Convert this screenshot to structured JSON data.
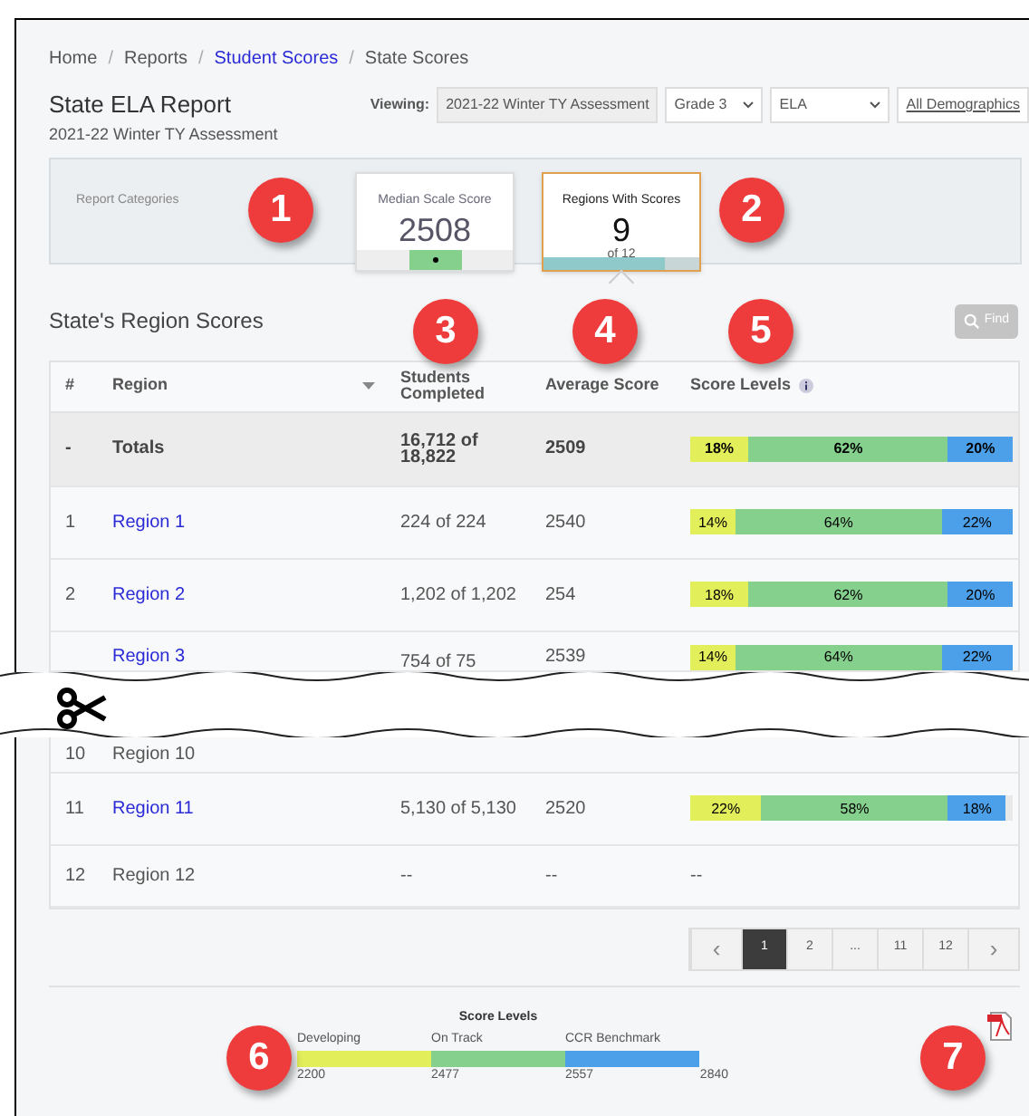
{
  "breadcrumb": [
    {
      "label": "Home",
      "kind": "plain"
    },
    {
      "label": "Reports",
      "kind": "plain"
    },
    {
      "label": "Student Scores",
      "kind": "link"
    },
    {
      "label": "State Scores",
      "kind": "plain"
    }
  ],
  "breadcrumb_separator": "/",
  "title": "State ELA Report",
  "subtitle": "2021-22 Winter TY Assessment",
  "viewing": {
    "label": "Viewing:",
    "assessment": "2021-22 Winter TY Assessment",
    "grade": "Grade 3",
    "subject": "ELA",
    "demographics": "All Demographics"
  },
  "categories": {
    "label": "Report Categories",
    "cards": [
      {
        "kind": "median",
        "title": "Median Scale Score",
        "value": "2508",
        "selected": false
      },
      {
        "kind": "regions",
        "title": "Regions With Scores",
        "value": "9",
        "sub": "of 12",
        "selected": true,
        "level": 0.78
      }
    ]
  },
  "section_title": "State's Region Scores",
  "find_button": "Find",
  "table": {
    "columns": [
      "#",
      "Region",
      "Students Completed",
      "Average Score",
      "Score Levels"
    ],
    "rows_top": [
      {
        "kind": "total",
        "num": "-",
        "region": "Totals",
        "students": "16,712 of 18,822",
        "average": "2509",
        "levels": [
          {
            "kind": "developing",
            "label": "18%"
          },
          {
            "kind": "on_track",
            "label": "62%"
          },
          {
            "kind": "ccr",
            "label": "20%"
          }
        ]
      },
      {
        "kind": "link",
        "num": "1",
        "region": "Region 1",
        "students": "224 of 224",
        "average": "2540",
        "levels": [
          {
            "kind": "developing",
            "label": "14%"
          },
          {
            "kind": "on_track",
            "label": "64%"
          },
          {
            "kind": "ccr",
            "label": "22%"
          }
        ]
      },
      {
        "kind": "link",
        "num": "2",
        "region": "Region 2",
        "students": "1,202 of 1,202",
        "average": "254",
        "levels": [
          {
            "kind": "developing",
            "label": "18%"
          },
          {
            "kind": "on_track",
            "label": "62%"
          },
          {
            "kind": "ccr",
            "label": "20%"
          }
        ]
      },
      {
        "kind": "link",
        "region": "Region 3",
        "students": "754 of 75",
        "average": "2539",
        "levels": [
          {
            "kind": "developing",
            "label": "14%"
          },
          {
            "kind": "on_track",
            "label": "64%"
          },
          {
            "kind": "ccr",
            "label": "22%"
          }
        ]
      }
    ],
    "rows_bottom": [
      {
        "kind": "plain",
        "num": "10",
        "region": "Region 10"
      },
      {
        "kind": "link",
        "num": "11",
        "region": "Region 11",
        "students": "5,130 of 5,130",
        "average": "2520",
        "levels": [
          {
            "kind": "developing",
            "label": "22%"
          },
          {
            "kind": "on_track",
            "label": "58%"
          },
          {
            "kind": "ccr",
            "label": "18%"
          }
        ]
      },
      {
        "kind": "plain",
        "num": "12",
        "region": "Region 12",
        "students": "--",
        "average": "--",
        "levels_text": "--"
      }
    ]
  },
  "pagination": [
    {
      "kind": "prev",
      "label": "‹",
      "selected": false
    },
    {
      "kind": "page",
      "label": "1",
      "selected": true
    },
    {
      "kind": "page",
      "label": "2",
      "selected": false
    },
    {
      "kind": "gap",
      "label": "...",
      "selected": false
    },
    {
      "kind": "page",
      "label": "11",
      "selected": false
    },
    {
      "kind": "page",
      "label": "12",
      "selected": false
    },
    {
      "kind": "next",
      "label": "›",
      "selected": false
    }
  ],
  "legend": {
    "title": "Score Levels",
    "segments": [
      {
        "kind": "developing",
        "label": "Developing",
        "start": "2200"
      },
      {
        "kind": "on_track",
        "label": "On Track",
        "start": "2477"
      },
      {
        "kind": "ccr",
        "label": "CCR Benchmark",
        "start": "2557",
        "end": "2840"
      }
    ]
  },
  "callouts": [
    "1",
    "2",
    "3",
    "4",
    "5",
    "6",
    "7"
  ]
}
